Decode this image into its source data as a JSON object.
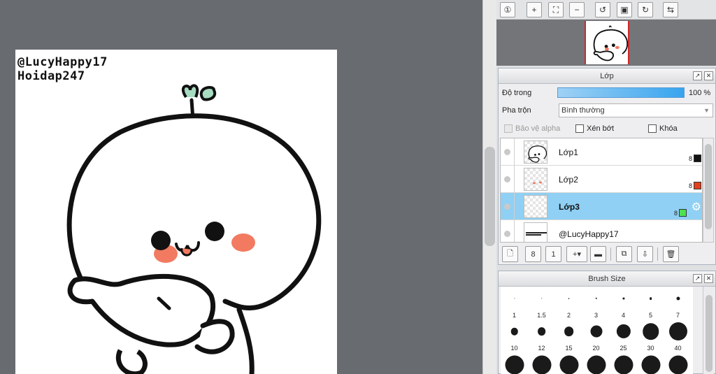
{
  "canvas": {
    "watermark": [
      "@LucyHappy17",
      "Hoidap247"
    ]
  },
  "nav_toolbar": {
    "buttons": [
      {
        "icon": "zoom-actual-icon",
        "glyph": "①"
      },
      {
        "icon": "zoom-in-icon",
        "glyph": "+"
      },
      {
        "icon": "fit-window-icon",
        "glyph": "⛶"
      },
      {
        "icon": "zoom-out-icon",
        "glyph": "−"
      },
      {
        "icon": "rotate-left-icon",
        "glyph": "↺"
      },
      {
        "icon": "reset-view-icon",
        "glyph": "▣"
      },
      {
        "icon": "rotate-right-icon",
        "glyph": "↻"
      },
      {
        "icon": "flip-horizontal-icon",
        "glyph": "⇆"
      }
    ]
  },
  "layer_panel": {
    "title": "Lớp",
    "opacity_label": "Độ trong",
    "opacity_value": "100 %",
    "opacity_fraction": 1.0,
    "blend_label": "Pha trộn",
    "blend_value": "Bình thường",
    "protect_alpha": "Bảo vệ alpha",
    "clipping": "Xén bớt",
    "lock": "Khóa",
    "layers": [
      {
        "name": "Lớp1",
        "bits": "8",
        "color": "#111111",
        "selected": false
      },
      {
        "name": "Lớp2",
        "bits": "8",
        "color": "#e2401c",
        "selected": false
      },
      {
        "name": "Lớp3",
        "bits": "8",
        "color": "#4ee24e",
        "selected": true
      },
      {
        "name": "@LucyHappy17",
        "bits": "",
        "color": "",
        "selected": false
      }
    ],
    "toolbar": [
      {
        "icon": "new-layer-icon",
        "glyph": "🗋"
      },
      {
        "icon": "new-8bit-layer-icon",
        "glyph": "8"
      },
      {
        "icon": "new-1bit-layer-icon",
        "glyph": "1"
      },
      {
        "icon": "add-layer-dropdown-icon",
        "glyph": "+▾"
      },
      {
        "icon": "folder-icon",
        "glyph": "▬"
      },
      {
        "icon": "duplicate-layer-icon",
        "glyph": "⧉"
      },
      {
        "icon": "merge-layer-icon",
        "glyph": "⇩"
      },
      {
        "icon": "trash-icon",
        "glyph": "🗑"
      }
    ]
  },
  "brush_panel": {
    "title": "Brush Size",
    "sizes": [
      "1",
      "1.5",
      "2",
      "3",
      "4",
      "5",
      "7",
      "10",
      "12",
      "15",
      "20",
      "25",
      "30",
      "40",
      "",
      "",
      "",
      "",
      "",
      "",
      ""
    ]
  }
}
